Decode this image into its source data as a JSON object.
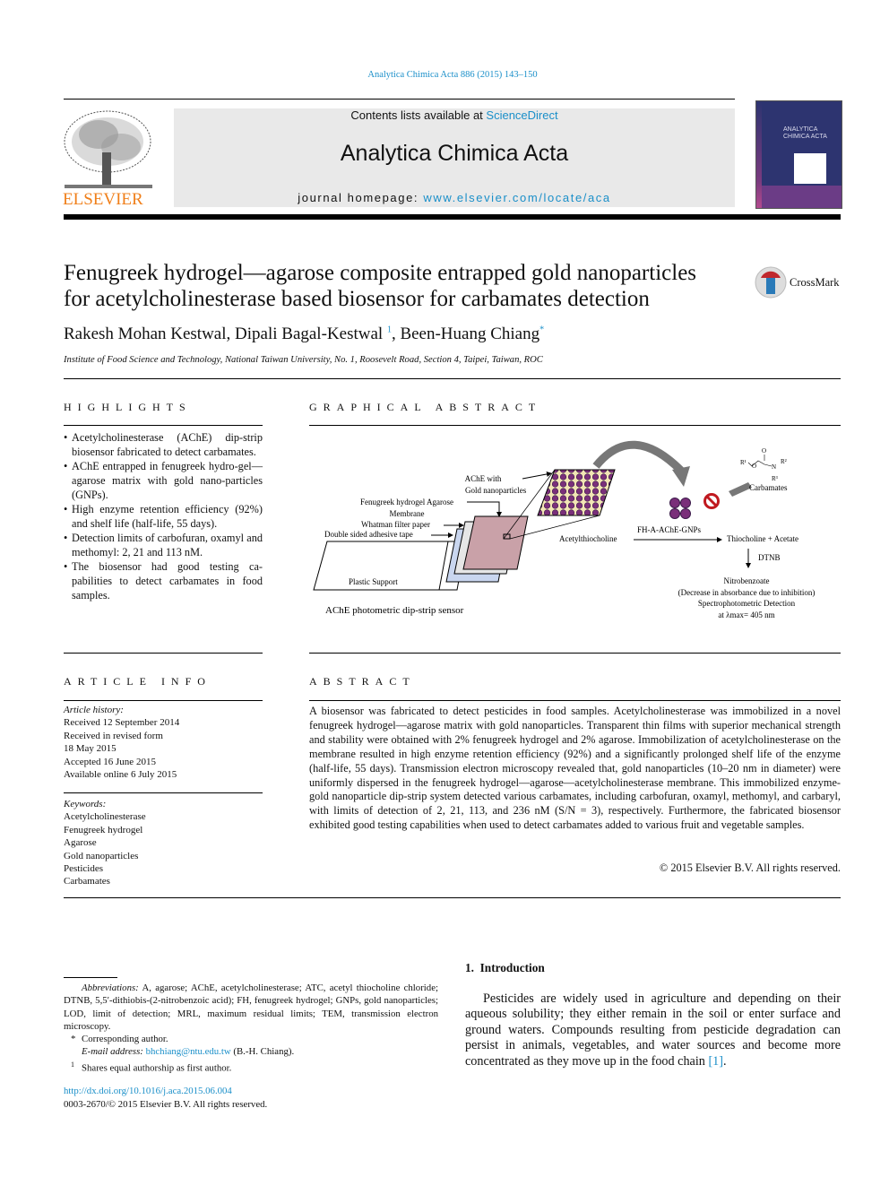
{
  "header": {
    "citation": "Analytica Chimica Acta 886 (2015) 143–150",
    "contents_prefix": "Contents lists available at ",
    "contents_link": "ScienceDirect",
    "journal_title": "Analytica Chimica Acta",
    "homepage_prefix": "journal homepage: ",
    "homepage_link": "www.elsevier.com/locate/aca",
    "publisher_logo": "ELSEVIER",
    "cover_title": "ANALYTICA CHIMICA ACTA"
  },
  "article": {
    "title_line1": "Fenugreek hydrogel—agarose composite entrapped gold nanoparticles",
    "title_line2": "for acetylcholinesterase based biosensor for carbamates detection",
    "crossmark": "CrossMark",
    "authors": [
      {
        "name": "Rakesh Mohan Kestwal, "
      },
      {
        "name": "Dipali Bagal-Kestwal ",
        "mark": "1"
      },
      {
        "name": ", Been-Huang Chiang",
        "mark": "*"
      }
    ],
    "affiliation": "Institute of Food Science and Technology, National Taiwan University, No. 1, Roosevelt Road, Section 4, Taipei, Taiwan, ROC"
  },
  "highlights": {
    "heading": "HIGHLIGHTS",
    "items": [
      "Acetylcholinesterase (AChE) dip-strip biosensor fabricated to detect carbamates.",
      "AChE entrapped in fenugreek hydro-gel—agarose matrix with gold nano-particles (GNPs).",
      "High enzyme retention efficiency (92%) and shelf life (half-life, 55 days).",
      "Detection limits of carbofuran, oxamyl and methomyl: 2, 21 and 113 nM.",
      "The biosensor had good testing ca-pabilities to detect carbamates in food samples."
    ]
  },
  "graphical_abstract": {
    "heading": "GRAPHICAL ABSTRACT",
    "labels": {
      "ache_with": "AChE with",
      "gold_np": "Gold nanoparticles",
      "membrane1": "Fenugreek hydrogel Agarose",
      "membrane2": "Membrane",
      "whatman": "Whatman filter paper",
      "tape": "Double sided adhesive tape",
      "plastic": "Plastic Support",
      "caption": "AChE photometric dip-strip sensor",
      "enzyme": "FH-A-AChE-GNPs",
      "substrate": "Acetylthiocholine",
      "products": "Thiocholine + Acetate",
      "dtnb": "DTNB",
      "carbamates": "Carbamates",
      "r1": "R¹",
      "r2": "R²",
      "r3": "R³",
      "o1": "O",
      "o2": "O",
      "n": "N",
      "nitro": "Nitrobenzoate",
      "decrease": "(Decrease in absorbance due to inhibition)",
      "spectro": "Spectrophotometric Detection",
      "lambda": "at λmax= 405 nm"
    }
  },
  "article_info": {
    "heading": "ARTICLE INFO",
    "history_label": "Article history:",
    "history": [
      "Received 12 September 2014",
      "Received in revised form",
      "18 May 2015",
      "Accepted 16 June 2015",
      "Available online 6 July 2015"
    ],
    "keywords_label": "Keywords:",
    "keywords": [
      "Acetylcholinesterase",
      "Fenugreek hydrogel",
      "Agarose",
      "Gold nanoparticles",
      "Pesticides",
      "Carbamates"
    ]
  },
  "abstract": {
    "heading": "ABSTRACT",
    "text": "A biosensor was fabricated to detect pesticides in food samples. Acetylcholinesterase was immobilized in a novel fenugreek hydrogel—agarose matrix with gold nanoparticles. Transparent thin films with superior mechanical strength and stability were obtained with 2% fenugreek hydrogel and 2% agarose. Immobilization of acetylcholinesterase on the membrane resulted in high enzyme retention efficiency (92%) and a significantly prolonged shelf life of the enzyme (half-life, 55 days). Transmission electron microscopy revealed that, gold nanoparticles (10–20 nm in diameter) were uniformly dispersed in the fenugreek hydrogel—agarose—acetylcholinesterase membrane. This immobilized enzyme-gold nanoparticle dip-strip system detected various carbamates, including carbofuran, oxamyl, methomyl, and carbaryl, with limits of detection of 2, 21, 113, and 236 nM (S/N = 3), respectively. Furthermore, the fabricated biosensor exhibited good testing capabilities when used to detect carbamates added to various fruit and vegetable samples.",
    "copyright": "© 2015 Elsevier B.V. All rights reserved."
  },
  "footnotes": {
    "abbreviations_label": "Abbreviations:",
    "abbreviations": " A, agarose; AChE, acetylcholinesterase; ATC, acetyl thiocholine chloride; DTNB, 5,5′-dithiobis-(2-nitrobenzoic acid); FH, fenugreek hydrogel; GNPs, gold nanoparticles; LOD, limit of detection; MRL, maximum residual limits; TEM, transmission electron microscopy.",
    "corr_mark": "*",
    "corr": "Corresponding author.",
    "email_label": "E-mail address: ",
    "email": "bhchiang@ntu.edu.tw",
    "email_suffix": " (B.-H. Chiang).",
    "share_mark": "1",
    "share": "Shares equal authorship as first author.",
    "doi": "http://dx.doi.org/10.1016/j.aca.2015.06.004",
    "issn": "0003-2670/© 2015 Elsevier B.V. All rights reserved."
  },
  "introduction": {
    "heading": "1.  Introduction",
    "text": "Pesticides are widely used in agriculture and depending on their aqueous solubility; they either remain in the soil or enter surface and ground waters. Compounds resulting from pesticide degradation can persist in animals, vegetables, and water sources and become more concentrated as they move up in the food chain ",
    "ref": "[1]",
    "end": "."
  },
  "colors": {
    "link": "#1a8fc9",
    "elsevier_orange": "#f07f1a",
    "banner_gray": "#e9e9e9",
    "cover_blue": "#2d3470"
  }
}
